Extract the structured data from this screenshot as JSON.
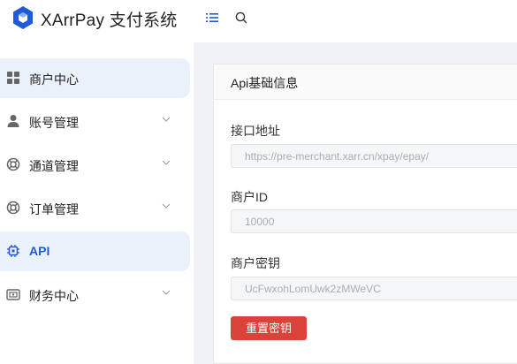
{
  "header": {
    "brand": "XArrPay 支付系统",
    "logo_icon": "hexagon-logo-icon",
    "menu_icon": "menu-toggle-icon",
    "search_icon": "search-icon",
    "accent": "#1e5bd6"
  },
  "sidebar": {
    "items": [
      {
        "label": "商户中心",
        "icon": "grid-icon",
        "active": true,
        "expandable": false
      },
      {
        "label": "账号管理",
        "icon": "user-icon",
        "active": false,
        "expandable": true
      },
      {
        "label": "通道管理",
        "icon": "lifebuoy-icon",
        "active": false,
        "expandable": true
      },
      {
        "label": "订单管理",
        "icon": "lifebuoy-icon",
        "active": false,
        "expandable": true
      },
      {
        "label": "API",
        "icon": "chip-icon",
        "active": true,
        "expandable": false
      },
      {
        "label": "财务中心",
        "icon": "finance-icon",
        "active": false,
        "expandable": true
      }
    ]
  },
  "main": {
    "card_title": "Api基础信息",
    "fields": [
      {
        "label": "接口地址",
        "value": "https://pre-merchant.xarr.cn/xpay/epay/"
      },
      {
        "label": "商户ID",
        "value": "10000"
      },
      {
        "label": "商户密钥",
        "value": "UcFwxohLomUwk2zMWeVC"
      }
    ],
    "reset_button": "重置密钥",
    "danger_color": "#d9433a"
  }
}
